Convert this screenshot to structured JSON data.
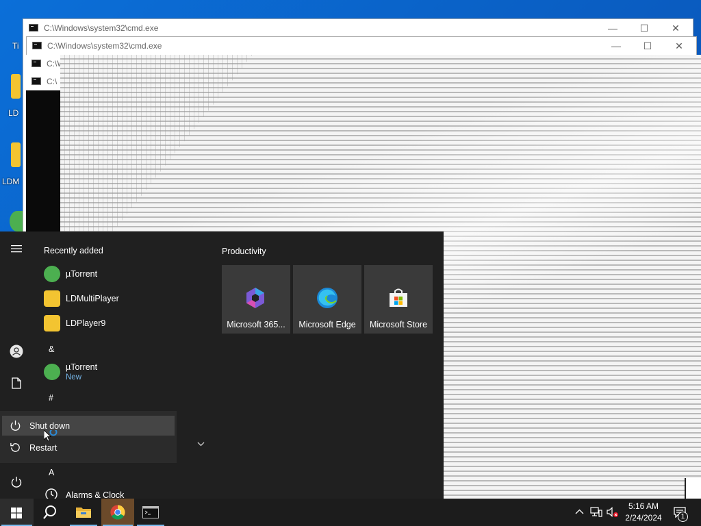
{
  "desktop": {
    "icons": [
      {
        "label": "Ti"
      },
      {
        "label": "LD"
      },
      {
        "label": "LDM"
      }
    ]
  },
  "windows": [
    {
      "title": "C:\\Windows\\system32\\cmd.exe"
    },
    {
      "title": "C:\\Windows\\system32\\cmd.exe"
    },
    {
      "title": "C:\\Windo"
    },
    {
      "title": "C:\\"
    }
  ],
  "start_menu": {
    "recently_added_title": "Recently added",
    "productivity_title": "Productivity",
    "recent_apps": [
      {
        "name": "µTorrent",
        "icon": "utorrent-icon"
      },
      {
        "name": "LDMultiPlayer",
        "icon": "ldmultiplayer-icon"
      },
      {
        "name": "LDPlayer9",
        "icon": "ldplayer9-icon"
      }
    ],
    "letter_amp": "&",
    "amp_app": {
      "name": "µTorrent",
      "sub": "New"
    },
    "letter_hash": "#",
    "letter_a": "A",
    "a_app": {
      "name": "Alarms & Clock"
    },
    "power_menu": {
      "shutdown_label": "Shut down",
      "restart_label": "Restart"
    },
    "tiles": [
      {
        "label": "Microsoft 365...",
        "icon": "microsoft-365-icon"
      },
      {
        "label": "Microsoft Edge",
        "icon": "edge-icon"
      },
      {
        "label": "Microsoft Store",
        "icon": "store-icon"
      }
    ]
  },
  "taskbar": {
    "time": "5:16 AM",
    "date": "2/24/2024",
    "notification_count": "1"
  },
  "colors": {
    "accent": "#76b9ed",
    "start_bg": "#202020",
    "taskbar_bg": "#1c1c1c",
    "desktop_blue": "#0a63c9"
  }
}
